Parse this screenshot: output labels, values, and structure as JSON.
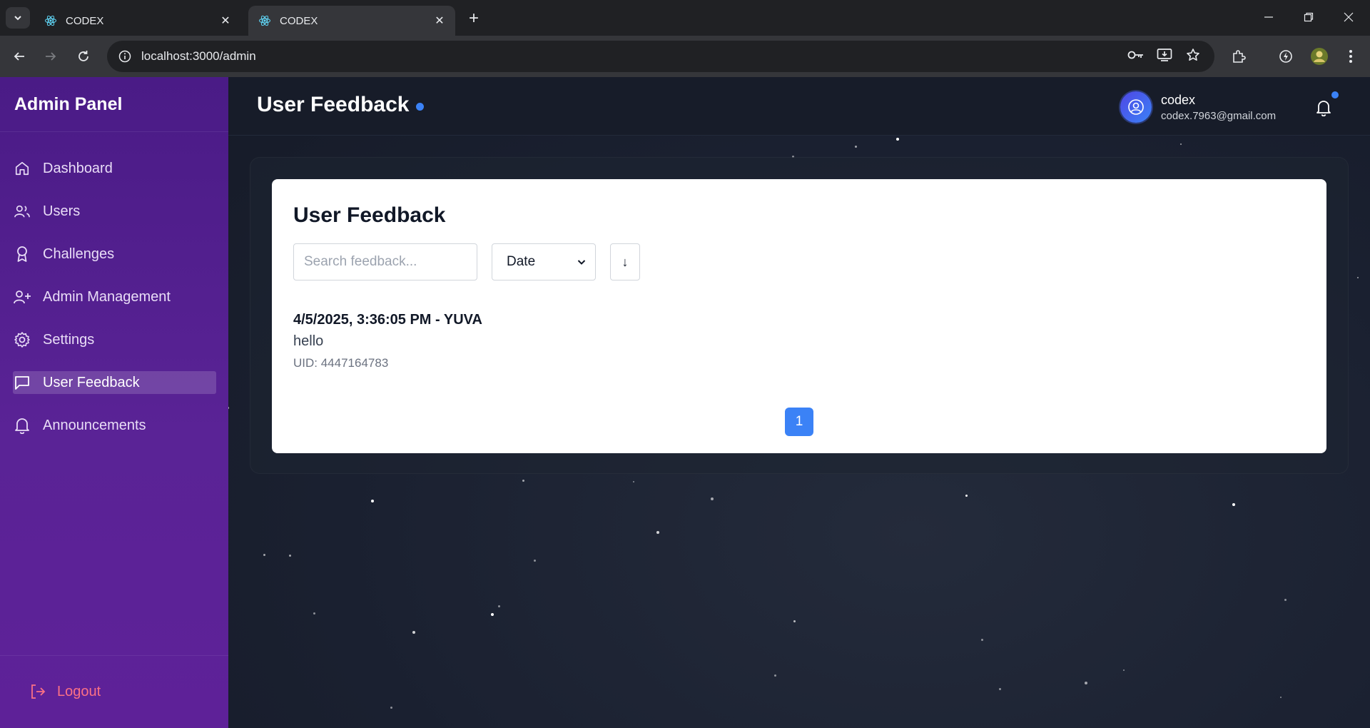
{
  "browser": {
    "tabs": [
      {
        "title": "CODEX",
        "active": false
      },
      {
        "title": "CODEX",
        "active": true
      }
    ],
    "url": "localhost:3000/admin"
  },
  "sidebar": {
    "brand": "Admin Panel",
    "items": [
      {
        "label": "Dashboard",
        "icon": "home-icon"
      },
      {
        "label": "Users",
        "icon": "users-icon"
      },
      {
        "label": "Challenges",
        "icon": "award-icon"
      },
      {
        "label": "Admin Management",
        "icon": "user-plus-icon"
      },
      {
        "label": "Settings",
        "icon": "gear-icon"
      },
      {
        "label": "User Feedback",
        "icon": "message-square-icon",
        "active": true
      },
      {
        "label": "Announcements",
        "icon": "bell-icon"
      }
    ],
    "logout_label": "Logout"
  },
  "header": {
    "title": "User Feedback",
    "user": {
      "name": "codex",
      "email": "codex.7963@gmail.com"
    }
  },
  "feedback": {
    "title": "User Feedback",
    "search_placeholder": "Search feedback...",
    "sort_by": "Date",
    "sort_direction": "↓",
    "items": [
      {
        "meta": "4/5/2025, 3:36:05 PM - YUVA",
        "message": "hello",
        "uid": "UID: 4447164783"
      }
    ],
    "pages": [
      "1"
    ],
    "current_page": "1"
  },
  "colors": {
    "sidebar": "#5a2396",
    "accent": "#3b82f6",
    "logout": "#fb7185",
    "background": "#1a2030"
  }
}
